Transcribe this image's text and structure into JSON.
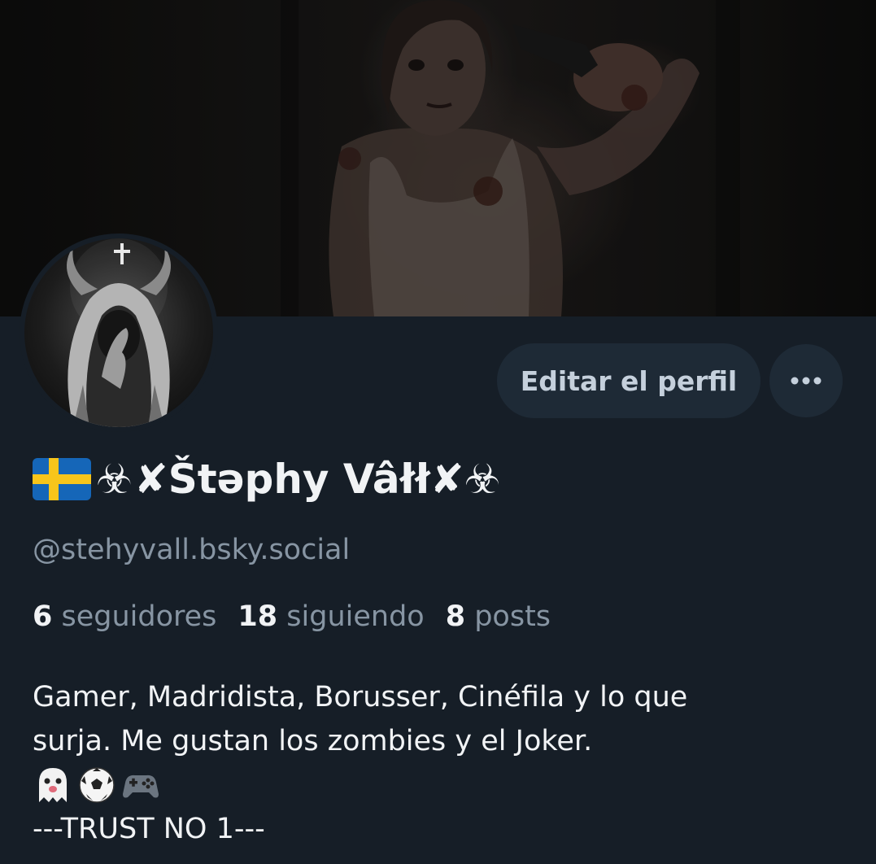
{
  "profile": {
    "display_name_prefix_icons": [
      "sweden-flag-icon",
      "biohazard-icon"
    ],
    "display_name_text": "✘Štəphy Vâłł✘",
    "display_name_suffix_icons": [
      "biohazard-icon"
    ],
    "handle": "@stehyvall.bsky.social",
    "stats": [
      {
        "num": "6",
        "label": "seguidores"
      },
      {
        "num": "18",
        "label": "siguiendo"
      },
      {
        "num": "8",
        "label": "posts"
      }
    ],
    "bio": {
      "line1": "Gamer, Madridista, Borusser, Cinéfila y lo que",
      "line2": "surja. Me gustan los zombies y el Joker.",
      "emojis": [
        "ghost-icon",
        "soccer-ball-icon",
        "game-controller-icon"
      ],
      "line4": "---TRUST NO 1---"
    }
  },
  "actions": {
    "edit_label": "Editar el perfil",
    "more_icon": "ellipsis-icon"
  },
  "colors": {
    "background": "#161e27",
    "button_bg": "#1e2a36",
    "primary_text": "#f1f3f5",
    "secondary_text": "#8795a3",
    "button_text": "#c5d0dc"
  }
}
